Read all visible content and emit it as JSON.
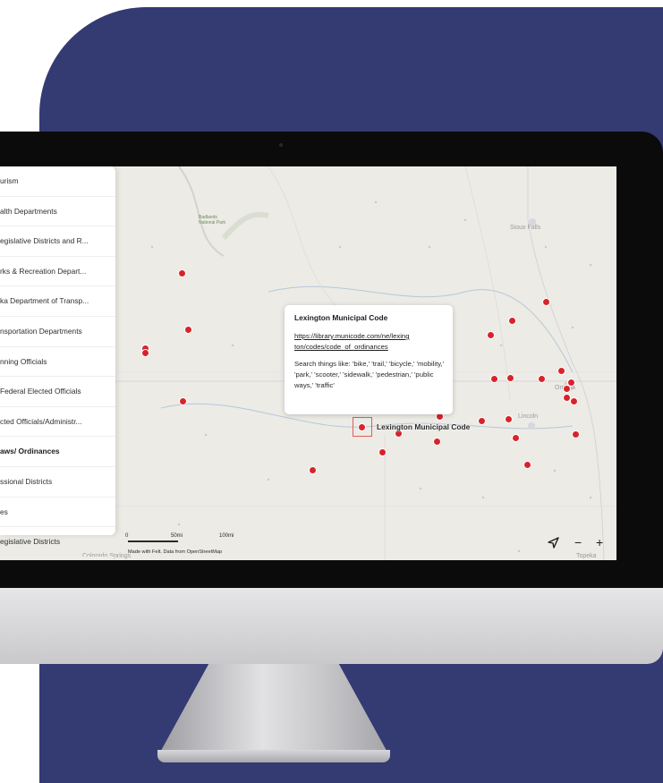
{
  "sidebar": {
    "items": [
      {
        "label": "urism"
      },
      {
        "label": "alth Departments"
      },
      {
        "label": "egislative Districts and R..."
      },
      {
        "label": "rks & Recreation Depart..."
      },
      {
        "label": "ka Department of Transp..."
      },
      {
        "label": "nsportation Departments"
      },
      {
        "label": "nning Officials"
      },
      {
        "label": "Federal Elected Officials"
      },
      {
        "label": "cted Officials/Administr..."
      },
      {
        "label": "aws/ Ordinances"
      },
      {
        "label": "ssional Districts"
      },
      {
        "label": "es"
      },
      {
        "label": "egislative Districts"
      }
    ],
    "active_index": 9
  },
  "map": {
    "places": {
      "badlands": "Badlands\nNational Park",
      "sioux_falls": "Sioux Falls",
      "omaha": "Omaha",
      "lincoln": "Lincoln",
      "colorado_springs": "Colorado Springs",
      "topeka": "Topeka"
    },
    "selected_label": "Lexington Municipal Code",
    "pin_color": "#d8232a",
    "scale": {
      "zero": "0",
      "mid": "50mi",
      "max": "100mi"
    },
    "attribution": "Made with Felt. Data from OpenStreetMap",
    "controls": {
      "locate_icon": "navigation-arrow-icon",
      "zoom_out": "−",
      "zoom_in": "+"
    }
  },
  "popup": {
    "title": "Lexington Municipal Code",
    "link": "https://library.municode.com/ne/lexington/codes/code_of_ordinances",
    "link_line1": "https://library.municode.com/ne/lexing",
    "link_line2": "ton/codes/code_of_ordinances",
    "description": "Search things like: 'bike,' 'trail,' 'bicycle,' 'mobility,' 'park,' 'scooter,' 'sidewalk,' 'pedestrian,' 'public ways,' 'traffic'"
  },
  "colors": {
    "background_accent": "#343a72",
    "monitor_bezel": "#0b0b0c",
    "map_base": "#ecebe5"
  }
}
